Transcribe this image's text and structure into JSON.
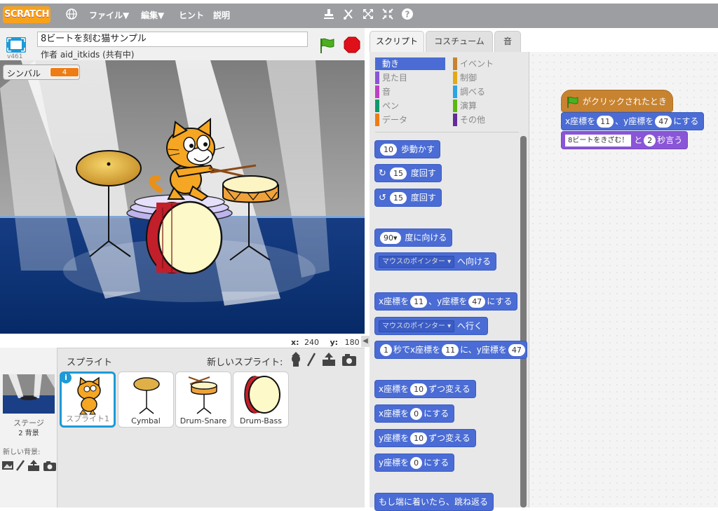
{
  "menubar": {
    "logo": "SCRATCH",
    "file": "ファイル▼",
    "edit": "編集▼",
    "hints": "ヒント",
    "about": "説明"
  },
  "stage_header": {
    "version": "v461",
    "project_title": "8ビートを刻む猫サンプル",
    "author": "作者 aid_itkids (共有中)"
  },
  "monitor": {
    "label": "シンバル",
    "value": "4"
  },
  "coords": {
    "x_label": "x:",
    "x": "240",
    "y_label": "y:",
    "y": "180"
  },
  "sprites_panel": {
    "header": "スプライト",
    "new_sprite": "新しいスプライト:",
    "stage_label": "ステージ",
    "stage_count": "2 背景",
    "new_backdrop": "新しい背景:",
    "sprites": [
      {
        "name": "スプライト1"
      },
      {
        "name": "Cymbal"
      },
      {
        "name": "Drum-Snare"
      },
      {
        "name": "Drum-Bass"
      }
    ]
  },
  "tabs": [
    "スクリプト",
    "コスチューム",
    "音"
  ],
  "categories": [
    {
      "label": "動き",
      "color": "#4a6cd4"
    },
    {
      "label": "見た目",
      "color": "#8a55d7"
    },
    {
      "label": "音",
      "color": "#bb42c3"
    },
    {
      "label": "ペン",
      "color": "#0e9a6c"
    },
    {
      "label": "データ",
      "color": "#ee7d16"
    },
    {
      "label": "イベント",
      "color": "#c88330"
    },
    {
      "label": "制御",
      "color": "#e1a91a"
    },
    {
      "label": "調べる",
      "color": "#2ca5e2"
    },
    {
      "label": "演算",
      "color": "#5cb712"
    },
    {
      "label": "その他",
      "color": "#632d99"
    }
  ],
  "palette": {
    "move": {
      "n": "10",
      "t": "歩動かす"
    },
    "turn_right": {
      "n": "15",
      "t": "度回す"
    },
    "turn_left": {
      "n": "15",
      "t": "度回す"
    },
    "point_dir": {
      "n": "90▾",
      "t": "度に向ける"
    },
    "point_towards": {
      "dd": "マウスのポインター ▾",
      "t": "へ向ける"
    },
    "goto_xy": {
      "a": "x座標を",
      "x": "11",
      "b": "、y座標を",
      "y": "47",
      "c": "にする"
    },
    "goto": {
      "dd": "マウスのポインター ▾",
      "t": "へ行く"
    },
    "glide": {
      "s": "1",
      "a": "秒でx座標を",
      "x": "11",
      "b": "に、y座標を",
      "y": "47"
    },
    "change_x": {
      "a": "x座標を",
      "n": "10",
      "t": "ずつ変える"
    },
    "set_x": {
      "a": "x座標を",
      "n": "0",
      "t": "にする"
    },
    "change_y": {
      "a": "y座標を",
      "n": "10",
      "t": "ずつ変える"
    },
    "set_y": {
      "a": "y座標を",
      "n": "0",
      "t": "にする"
    },
    "bounce": "もし端に着いたら、跳ね返る"
  },
  "script": {
    "hat": "がクリックされたとき",
    "goto": {
      "a": "x座標を",
      "x": "11",
      "b": "、y座標を",
      "y": "47",
      "c": "にする"
    },
    "say": {
      "text": "8ビートをきざむ！",
      "a": "と",
      "secs": "2",
      "b": "秒言う"
    }
  },
  "colors": {
    "motion": "#4a6cd4",
    "looks": "#8a55d7",
    "events": "#c88330",
    "accent": "#1e9ad6"
  }
}
